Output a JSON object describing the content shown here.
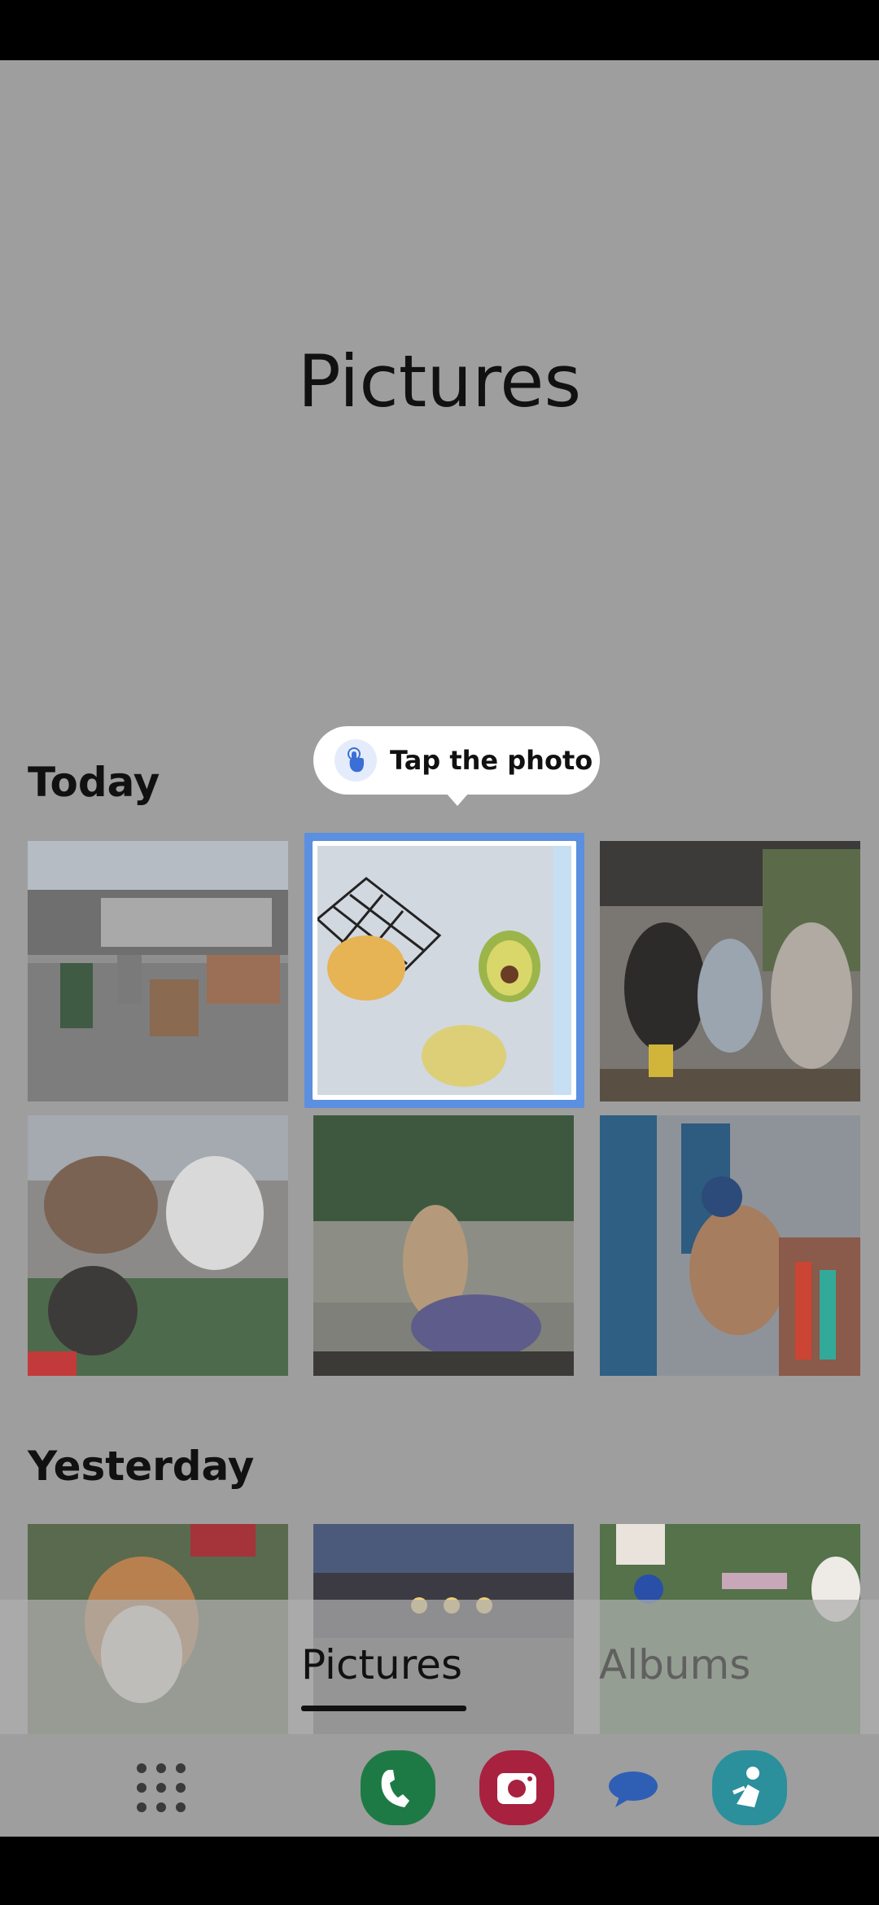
{
  "page": {
    "title": "Pictures"
  },
  "sections": [
    {
      "label": "Today"
    },
    {
      "label": "Yesterday"
    }
  ],
  "tooltip": {
    "text": "Tap the photo",
    "icon": "tap-hand-icon"
  },
  "tabs": [
    {
      "label": "Pictures",
      "active": true
    },
    {
      "label": "Albums",
      "active": false
    }
  ],
  "dock": {
    "apps": [
      {
        "name": "apps-grid-icon"
      },
      {
        "name": "phone-app-icon",
        "color": "#1e7a45"
      },
      {
        "name": "camera-app-icon",
        "color": "#a8213f"
      },
      {
        "name": "messages-app-icon",
        "color": "#2f5fb5"
      },
      {
        "name": "bixby-app-icon",
        "color": "#2b8f9c"
      }
    ]
  }
}
